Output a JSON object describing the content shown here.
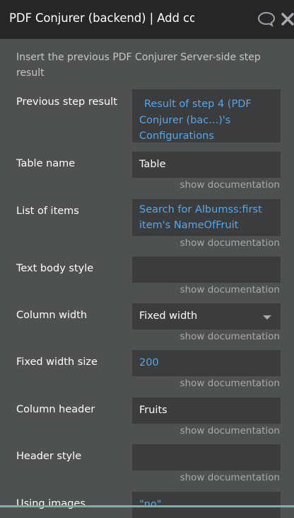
{
  "header": {
    "title": "PDF Conjurer (backend) | Add co",
    "icons": [
      "comment-icon",
      "close-icon"
    ]
  },
  "description": "Insert the previous PDF Conjurer Server-side step result",
  "fields": {
    "previous_step": {
      "label": "Previous step result",
      "value": "Result of step 4 (PDF Conjurer (bac...)'s Configurations"
    },
    "table_name": {
      "label": "Table name",
      "value": "Table",
      "doc": "show documentation"
    },
    "list_items": {
      "label": "List of items",
      "value": "Search for Albumss:first item's NameOfFruit",
      "doc": "show documentation"
    },
    "text_body_style": {
      "label": "Text body style",
      "value": "",
      "doc": "show documentation"
    },
    "column_width": {
      "label": "Column width",
      "value": "Fixed width",
      "doc": "show documentation"
    },
    "fixed_width_size": {
      "label": "Fixed width size",
      "value": "200",
      "doc": "show documentation"
    },
    "column_header": {
      "label": "Column header",
      "value": "Fruits",
      "doc": "show documentation"
    },
    "header_style": {
      "label": "Header style",
      "value": "",
      "doc": "show documentation"
    },
    "using_images": {
      "label": "Using images",
      "value": "\"no\""
    }
  },
  "colors": {
    "panel": "#4e5152",
    "header": "#252627",
    "field": "#3a3c3d",
    "dynamic_text": "#5aa6ea"
  }
}
